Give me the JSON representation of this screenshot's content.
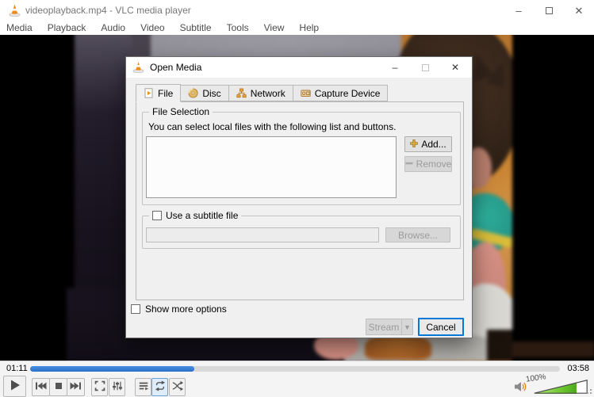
{
  "window": {
    "title": "videoplayback.mp4 - VLC media player"
  },
  "menu": {
    "items": [
      "Media",
      "Playback",
      "Audio",
      "Video",
      "Subtitle",
      "Tools",
      "View",
      "Help"
    ]
  },
  "dialog": {
    "title": "Open Media",
    "active_tab": "File",
    "tabs": [
      {
        "label": "File"
      },
      {
        "label": "Disc"
      },
      {
        "label": "Network"
      },
      {
        "label": "Capture Device"
      }
    ],
    "file_selection": {
      "legend": "File Selection",
      "description": "You can select local files with the following list and buttons.",
      "add_label": "Add...",
      "remove_label": "Remove"
    },
    "subtitle": {
      "legend": "Use a subtitle file",
      "path_value": "",
      "browse_label": "Browse..."
    },
    "show_more_options_label": "Show more options",
    "stream_label": "Stream",
    "cancel_label": "Cancel"
  },
  "player": {
    "elapsed": "01:11",
    "duration": "03:58",
    "progress_percent": 31,
    "volume_label": "100%",
    "volume_fill_percent": 80
  },
  "icons": {
    "minimize": "–",
    "close": "✕",
    "dropdown_arrow": "▼"
  },
  "colors": {
    "accent_blue": "#0078d7",
    "seek_progress_blue": "#2f7ed8",
    "volume_green": "#67c32b",
    "vlc_orange": "#ef7d00"
  }
}
